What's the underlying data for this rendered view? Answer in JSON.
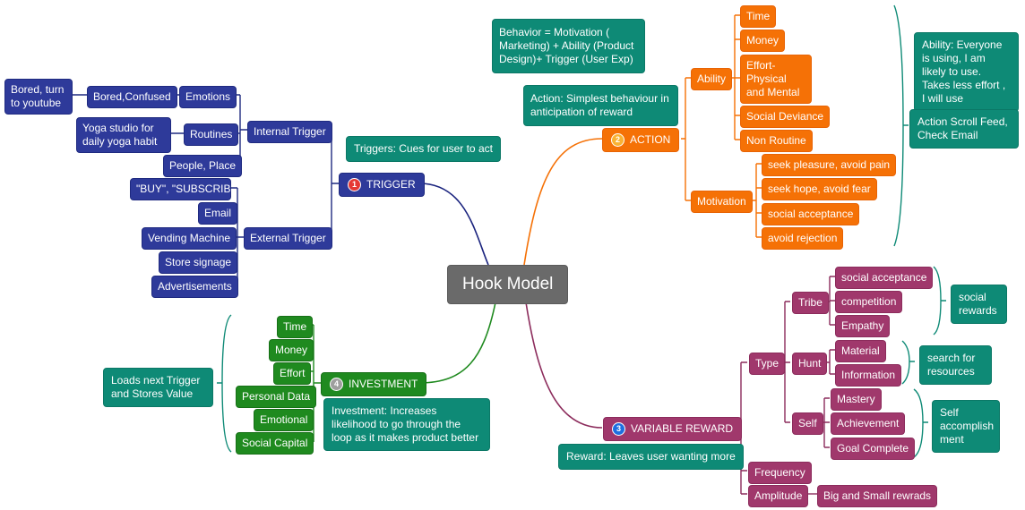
{
  "root": {
    "label": "Hook Model"
  },
  "colors": {
    "trigger": "#2e3a9a",
    "action": "#f57106",
    "reward": "#a0386c",
    "investment": "#1f8a1f",
    "note": "#0e8a76",
    "root": "#6a6a6a"
  },
  "trigger": {
    "badge": "1",
    "label": "TRIGGER",
    "note": "Triggers: Cues for user to act",
    "internal": {
      "label": "Internal Trigger",
      "emotions": {
        "label": "Emotions",
        "child": "Bored,Confused",
        "grandchild": "Bored, turn to youtube"
      },
      "routines": {
        "label": "Routines",
        "child": "Yoga studio for daily yoga habit"
      },
      "people": {
        "label": "People, Place"
      }
    },
    "external": {
      "label": "External Trigger",
      "items": [
        "\"BUY\", \"SUBSCRIBE",
        "Email",
        "Vending Machine",
        "Store signage",
        "Advertisements"
      ]
    }
  },
  "action": {
    "badge": "2",
    "label": "ACTION",
    "note": "Action: Simplest behaviour in anticipation of reward",
    "formula": "Behavior = Motivation ( Marketing) + Ability (Product Design)+ Trigger (User Exp)",
    "ability": {
      "label": "Ability",
      "items": [
        "Time",
        "Money",
        "Effort- Physical and Mental",
        "Social Deviance",
        "Non Routine"
      ]
    },
    "motivation": {
      "label": "Motivation",
      "items": [
        "seek pleasure, avoid pain",
        "seek hope, avoid fear",
        "social acceptance",
        "avoid rejection"
      ]
    },
    "summary_notes": [
      "Ability: Everyone is using, I am likely to use. Takes less effort , I will use",
      "Action Scroll Feed, Check Email"
    ]
  },
  "reward": {
    "badge": "3",
    "label": "VARIABLE REWARD",
    "note": "Reward: Leaves user wanting more",
    "type": {
      "label": "Type",
      "tribe": {
        "label": "Tribe",
        "items": [
          "social acceptance",
          "competition",
          "Empathy"
        ],
        "note": "social rewards"
      },
      "hunt": {
        "label": "Hunt",
        "items": [
          "Material",
          "Information"
        ],
        "note": "search for resources"
      },
      "self": {
        "label": "Self",
        "items": [
          "Mastery",
          "Achievement",
          "Goal Complete"
        ],
        "note": "Self accomplish ment"
      }
    },
    "frequency": {
      "label": "Frequency"
    },
    "amplitude": {
      "label": "Amplitude",
      "child": "Big and Small rewrads"
    }
  },
  "investment": {
    "badge": "4",
    "label": "INVESTMENT",
    "note": "Investment: Increases likelihood to go through the loop as it makes product better",
    "items": [
      "Time",
      "Money",
      "Effort",
      "Personal Data",
      "Emotional",
      "Social Capital"
    ],
    "summary_note": "Loads next Trigger and Stores Value"
  }
}
